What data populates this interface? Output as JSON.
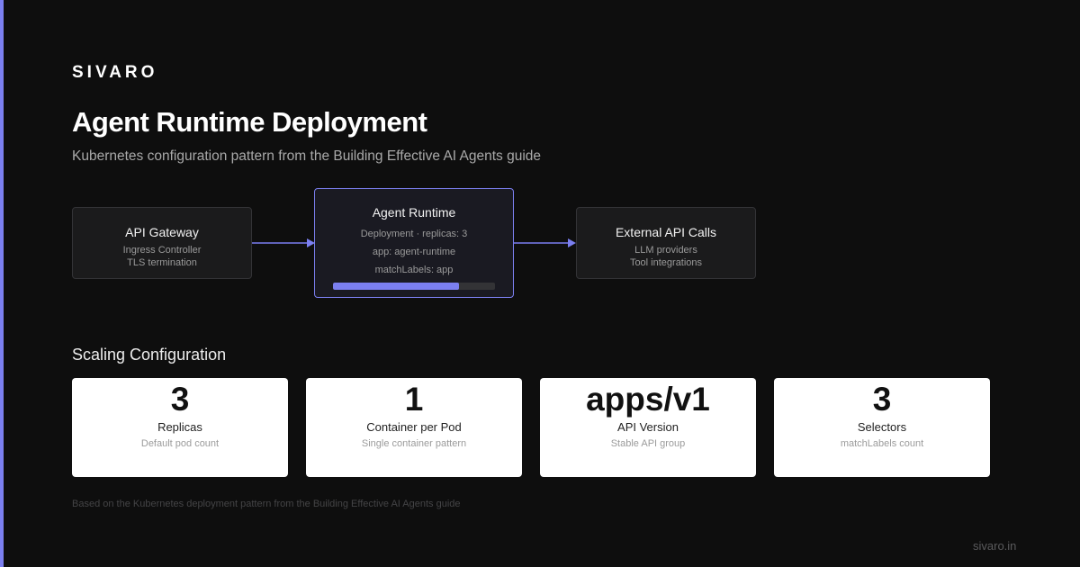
{
  "brand": "SIVARO",
  "title": "Agent Runtime Deployment",
  "subtitle": "Kubernetes configuration pattern from the Building Effective AI Agents guide",
  "colors": {
    "accent": "#7b7ff0",
    "background": "#0e0e0e",
    "node_background": "#1b1b1c",
    "card_background": "#ffffff"
  },
  "diagram": {
    "nodes": [
      {
        "title": "API Gateway",
        "lines": [
          "Ingress Controller",
          "TLS termination"
        ]
      },
      {
        "title": "Agent Runtime",
        "lines": [
          "Deployment · replicas: 3",
          "app: agent-runtime",
          "matchLabels: app"
        ],
        "progress": 0.78
      },
      {
        "title": "External API Calls",
        "lines": [
          "LLM providers",
          "Tool integrations"
        ]
      }
    ],
    "edges": [
      {
        "from": "API Gateway",
        "to": "Agent Runtime"
      },
      {
        "from": "Agent Runtime",
        "to": "External API Calls"
      }
    ]
  },
  "scaling": {
    "heading": "Scaling Configuration",
    "cards": [
      {
        "value": "3",
        "label": "Replicas",
        "desc": "Default pod count"
      },
      {
        "value": "1",
        "label": "Container per Pod",
        "desc": "Single container pattern"
      },
      {
        "value": "apps/v1",
        "label": "API Version",
        "desc": "Stable API group"
      },
      {
        "value": "3",
        "label": "Selectors",
        "desc": "matchLabels count"
      }
    ]
  },
  "footnote": "Based on the Kubernetes deployment pattern from the Building Effective AI Agents guide",
  "site": "sivaro.in"
}
